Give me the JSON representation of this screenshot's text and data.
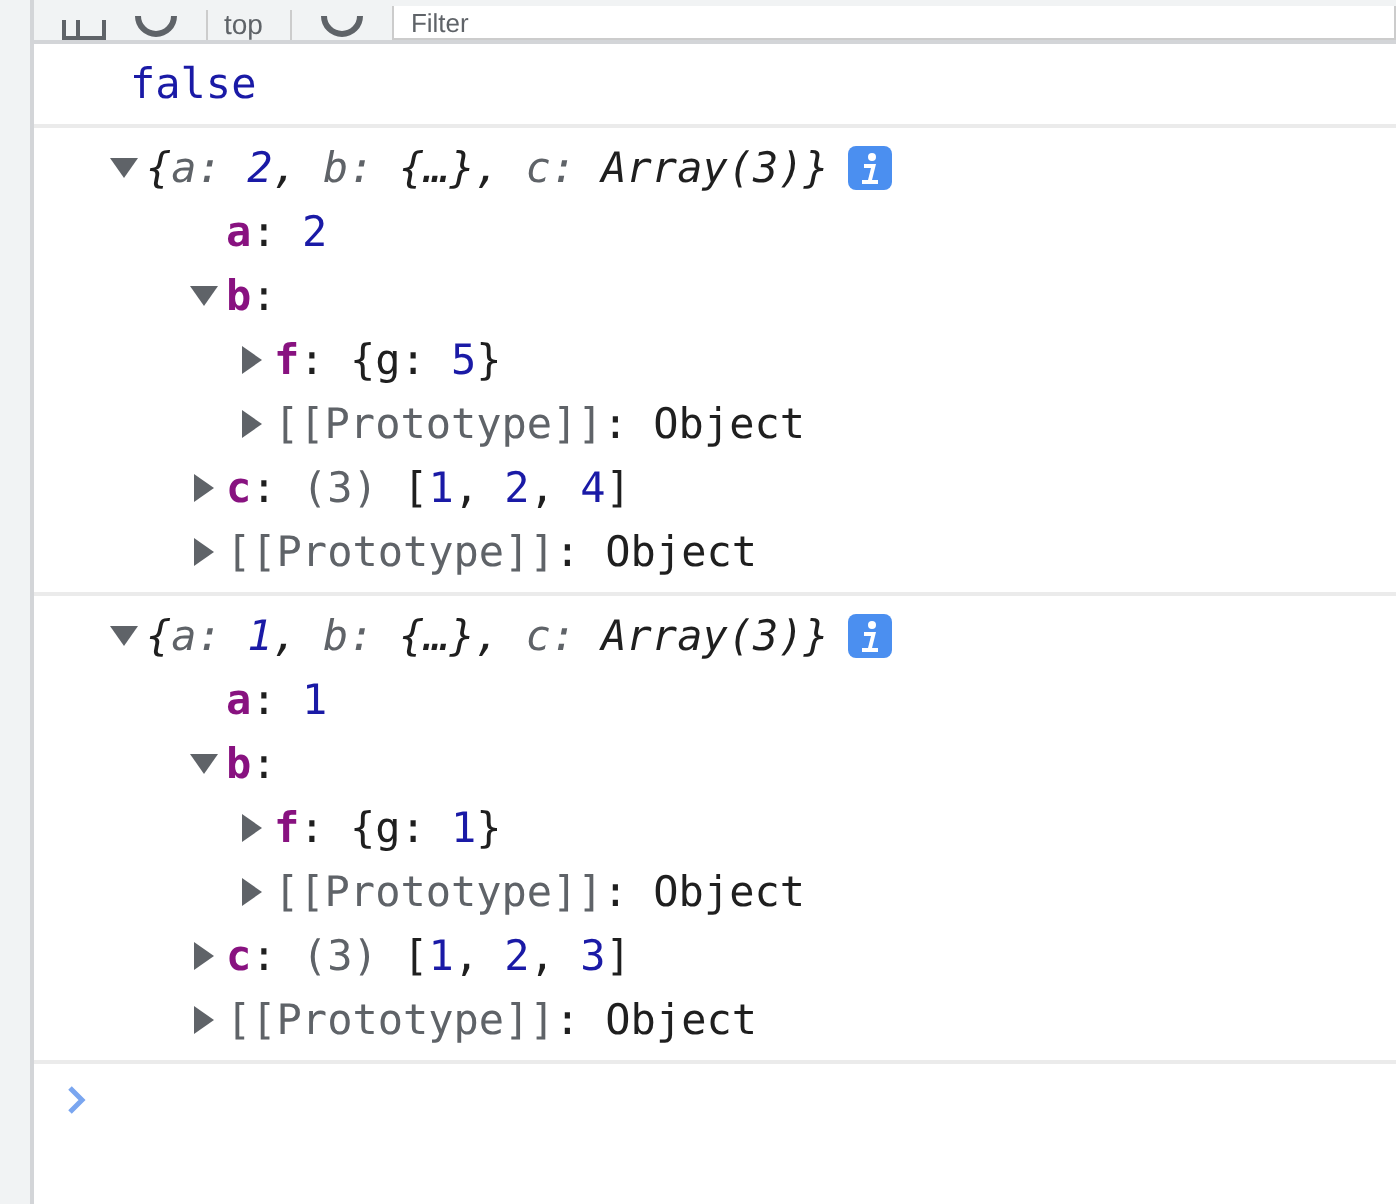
{
  "toolbar": {
    "context": "top",
    "filter": {
      "placeholder": "Filter"
    }
  },
  "messages": [
    {
      "kind": "text",
      "text": "false"
    },
    {
      "kind": "object",
      "expanded": true,
      "summary": [
        {
          "kind": "plain",
          "text": "{"
        },
        {
          "kind": "key",
          "text": "a: "
        },
        {
          "kind": "number",
          "text": "2"
        },
        {
          "kind": "plain",
          "text": ", "
        },
        {
          "kind": "key",
          "text": "b: "
        },
        {
          "kind": "plain",
          "text": "{…}, "
        },
        {
          "kind": "key",
          "text": "c: "
        },
        {
          "kind": "plain",
          "text": "Array(3)}"
        }
      ],
      "children": [
        {
          "kind": "property",
          "key": "a",
          "value": [
            {
              "kind": "plain",
              "text": ": "
            },
            {
              "kind": "number",
              "text": "2"
            }
          ]
        },
        {
          "kind": "property",
          "key": "b",
          "expanded": true,
          "value": [
            {
              "kind": "plain",
              "text": ":"
            }
          ],
          "children": [
            {
              "kind": "property",
              "key": "f",
              "expanded": false,
              "value": [
                {
                  "kind": "plain",
                  "text": ": {g: "
                },
                {
                  "kind": "number",
                  "text": "5"
                },
                {
                  "kind": "plain",
                  "text": "}"
                }
              ]
            },
            {
              "kind": "internal",
              "key": "[[Prototype]]",
              "expanded": false,
              "value": [
                {
                  "kind": "plain",
                  "text": ": Object"
                }
              ]
            }
          ]
        },
        {
          "kind": "property",
          "key": "c",
          "expanded": false,
          "value": [
            {
              "kind": "plain",
              "text": ": "
            },
            {
              "kind": "meta",
              "text": "(3) "
            },
            {
              "kind": "plain",
              "text": "["
            },
            {
              "kind": "number",
              "text": "1"
            },
            {
              "kind": "plain",
              "text": ", "
            },
            {
              "kind": "number",
              "text": "2"
            },
            {
              "kind": "plain",
              "text": ", "
            },
            {
              "kind": "number",
              "text": "4"
            },
            {
              "kind": "plain",
              "text": "]"
            }
          ]
        },
        {
          "kind": "internal",
          "key": "[[Prototype]]",
          "expanded": false,
          "value": [
            {
              "kind": "plain",
              "text": ": Object"
            }
          ]
        }
      ]
    },
    {
      "kind": "object",
      "expanded": true,
      "summary": [
        {
          "kind": "plain",
          "text": "{"
        },
        {
          "kind": "key",
          "text": "a: "
        },
        {
          "kind": "number",
          "text": "1"
        },
        {
          "kind": "plain",
          "text": ", "
        },
        {
          "kind": "key",
          "text": "b: "
        },
        {
          "kind": "plain",
          "text": "{…}, "
        },
        {
          "kind": "key",
          "text": "c: "
        },
        {
          "kind": "plain",
          "text": "Array(3)}"
        }
      ],
      "children": [
        {
          "kind": "property",
          "key": "a",
          "value": [
            {
              "kind": "plain",
              "text": ": "
            },
            {
              "kind": "number",
              "text": "1"
            }
          ]
        },
        {
          "kind": "property",
          "key": "b",
          "expanded": true,
          "value": [
            {
              "kind": "plain",
              "text": ":"
            }
          ],
          "children": [
            {
              "kind": "property",
              "key": "f",
              "expanded": false,
              "value": [
                {
                  "kind": "plain",
                  "text": ": {g: "
                },
                {
                  "kind": "number",
                  "text": "1"
                },
                {
                  "kind": "plain",
                  "text": "}"
                }
              ]
            },
            {
              "kind": "internal",
              "key": "[[Prototype]]",
              "expanded": false,
              "value": [
                {
                  "kind": "plain",
                  "text": ": Object"
                }
              ]
            }
          ]
        },
        {
          "kind": "property",
          "key": "c",
          "expanded": false,
          "value": [
            {
              "kind": "plain",
              "text": ": "
            },
            {
              "kind": "meta",
              "text": "(3) "
            },
            {
              "kind": "plain",
              "text": "["
            },
            {
              "kind": "number",
              "text": "1"
            },
            {
              "kind": "plain",
              "text": ", "
            },
            {
              "kind": "number",
              "text": "2"
            },
            {
              "kind": "plain",
              "text": ", "
            },
            {
              "kind": "number",
              "text": "3"
            },
            {
              "kind": "plain",
              "text": "]"
            }
          ]
        },
        {
          "kind": "internal",
          "key": "[[Prototype]]",
          "expanded": false,
          "value": [
            {
              "kind": "plain",
              "text": ": Object"
            }
          ]
        }
      ]
    }
  ]
}
